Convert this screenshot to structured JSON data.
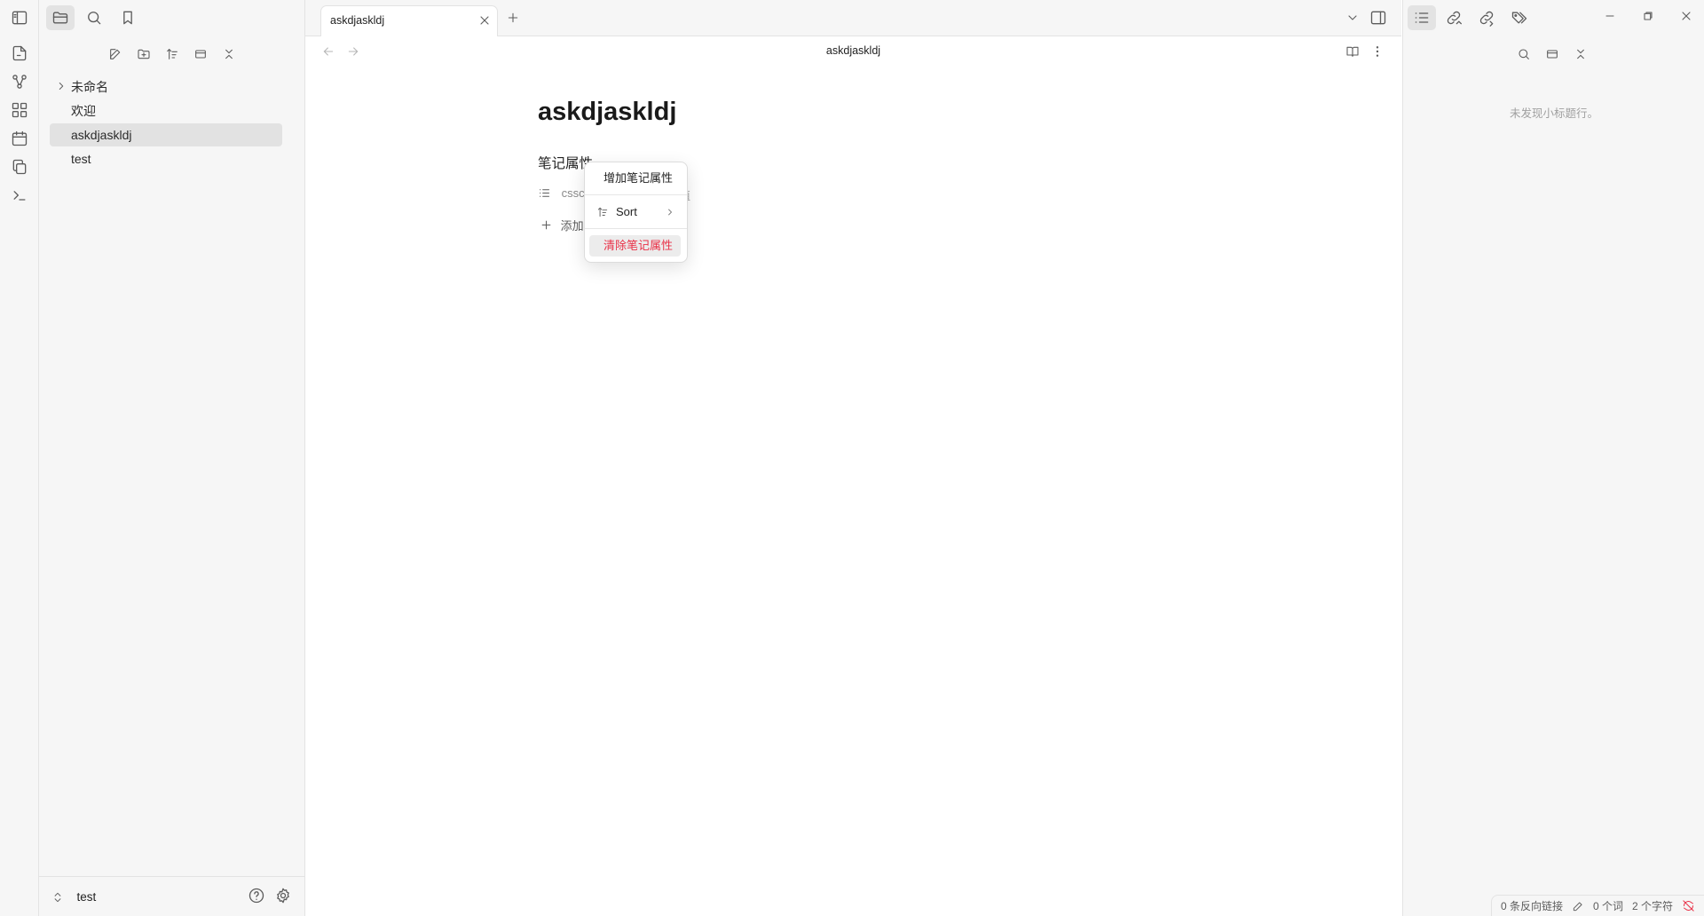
{
  "ribbon": {
    "items": [
      {
        "icon": "new-file-icon"
      },
      {
        "icon": "graph-view-icon"
      },
      {
        "icon": "canvas-icon"
      },
      {
        "icon": "daily-note-icon"
      },
      {
        "icon": "templates-icon"
      },
      {
        "icon": "command-palette-icon"
      }
    ]
  },
  "left_sidebar": {
    "tree": [
      {
        "label": "未命名",
        "type": "folder"
      },
      {
        "label": "欢迎",
        "type": "file"
      },
      {
        "label": "askdjaskldj",
        "type": "file",
        "selected": true
      },
      {
        "label": "test",
        "type": "file"
      }
    ],
    "vault_name": "test"
  },
  "tabs": [
    {
      "title": "askdjaskldj",
      "active": true
    }
  ],
  "view_header": {
    "title": "askdjaskldj"
  },
  "note": {
    "title": "askdjaskldj",
    "properties_heading": "笔记属性",
    "property_key": "cssc",
    "property_value_placeholder": "值",
    "add_property_label": "添加"
  },
  "context_menu": {
    "items": [
      {
        "label": "增加笔记属性"
      },
      {
        "label": "Sort",
        "has_submenu": true
      },
      {
        "label": "清除笔记属性",
        "danger": true
      }
    ]
  },
  "right_sidebar": {
    "empty_message": "未发现小标题行。"
  },
  "status_bar": {
    "backlinks": "0 条反向链接",
    "words": "0 个词",
    "chars": "2 个字符"
  },
  "colors": {
    "accent": "#7b6cd9",
    "danger": "#e93147",
    "sync_error": "#e93147"
  }
}
